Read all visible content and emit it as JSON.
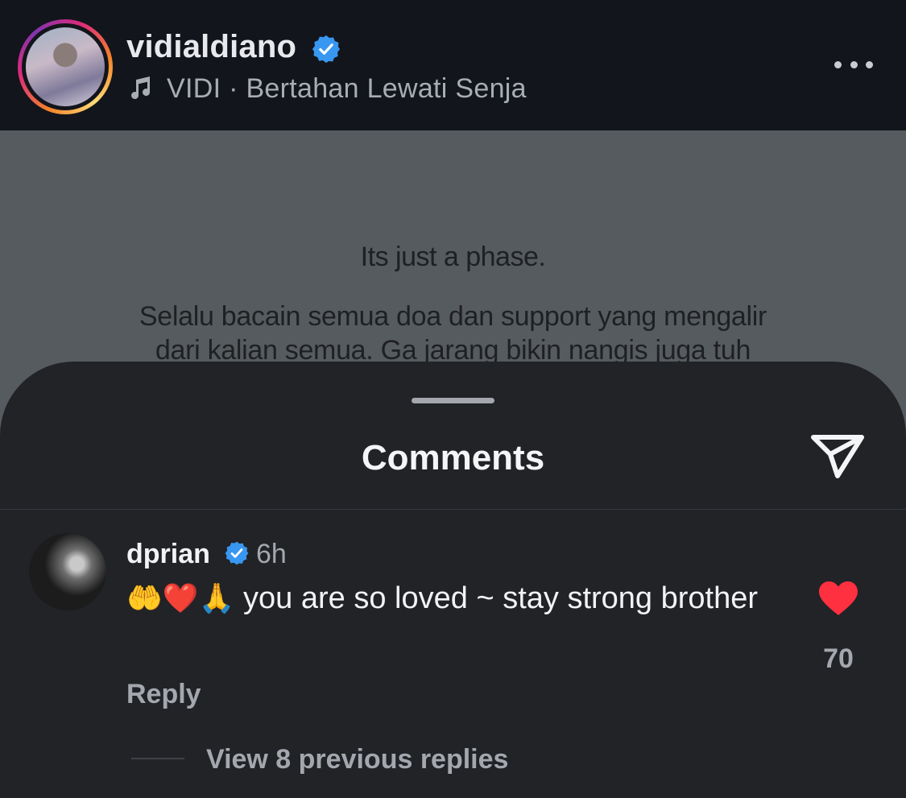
{
  "post": {
    "username": "vidialdiano",
    "audio": "VIDI · Bertahan Lewati Senja",
    "image_text": {
      "line1": "Its just a phase.",
      "line2": "Selalu bacain semua doa dan support yang mengalir",
      "line3": "dari kalian semua. Ga jarang bikin nangis juga tuh"
    }
  },
  "comments": {
    "title": "Comments",
    "items": [
      {
        "username": "dprian",
        "time": "6h",
        "emojis": "🤲❤️🙏",
        "text": "you are so loved ~ stay strong brother",
        "likes": "70",
        "reply_label": "Reply",
        "view_replies_label": "View 8 previous replies"
      }
    ]
  },
  "colors": {
    "verified": "#3897f0",
    "like": "#ff3040",
    "background": "#212327",
    "header_bg": "#12151b"
  }
}
